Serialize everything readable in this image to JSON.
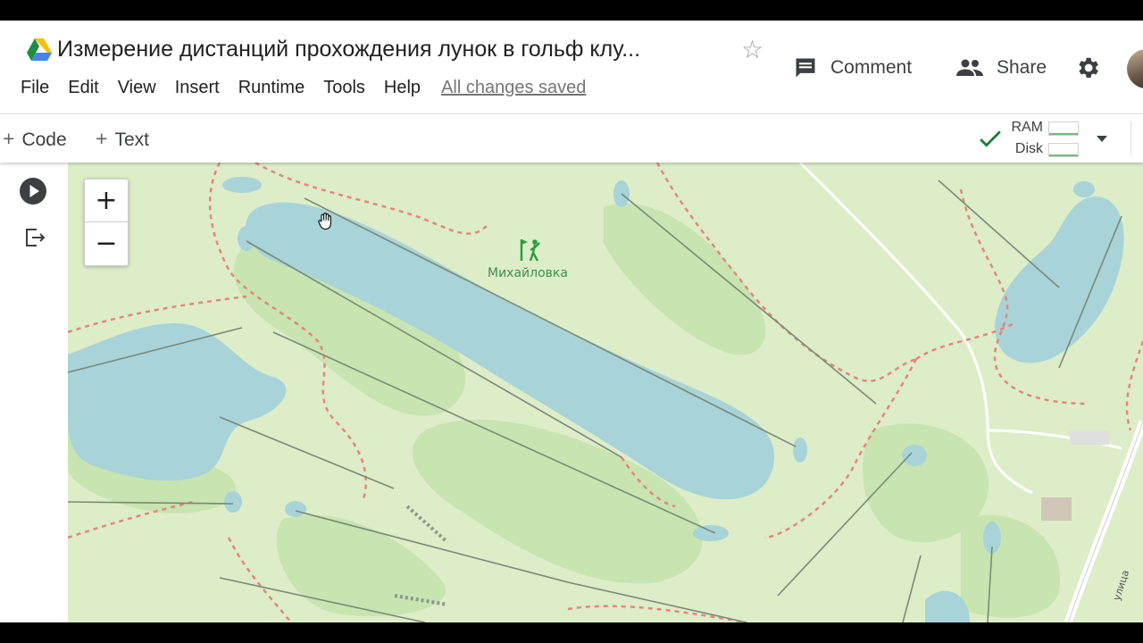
{
  "app": {
    "drive_icon": "google-drive-icon",
    "title": "Измерение дистанций прохождения лунок в гольф клу...",
    "star_icon": "star-outline-icon"
  },
  "menu": {
    "items": [
      "File",
      "Edit",
      "View",
      "Insert",
      "Runtime",
      "Tools",
      "Help"
    ],
    "status": "All changes saved"
  },
  "header_actions": {
    "comment_label": "Comment",
    "comment_icon": "comment-icon",
    "share_label": "Share",
    "share_icon": "people-icon",
    "settings_icon": "gear-icon"
  },
  "toolbar": {
    "add_code_label": "Code",
    "add_text_label": "Text",
    "resources": {
      "check_icon": "checkmark-icon",
      "ram_label": "RAM",
      "disk_label": "Disk",
      "connected_color": "#188038"
    }
  },
  "cell": {
    "run_icon": "play-circle-icon",
    "output_icon": "output-redirect-icon"
  },
  "map": {
    "zoom_in": "+",
    "zoom_out": "−",
    "place_label": "Михайловка",
    "place_icon": "golf-course-icon",
    "street_label": "улица",
    "colors": {
      "land": "#dcedc8",
      "fairway": "#c8e4b0",
      "water": "#a8d3d9",
      "path": "#e8857b",
      "hole_line": "#7a8a7a"
    }
  }
}
